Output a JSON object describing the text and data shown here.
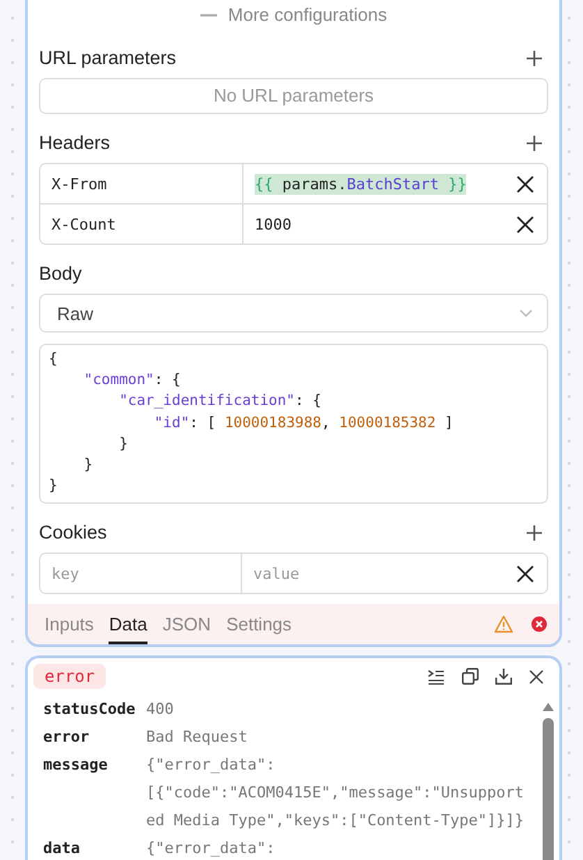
{
  "config_toggle": {
    "label": "More configurations"
  },
  "url_parameters": {
    "title": "URL parameters",
    "empty_text": "No URL parameters"
  },
  "headers": {
    "title": "Headers",
    "rows": [
      {
        "key": "X-From",
        "value": [
          {
            "kind": "brace",
            "text": "{{ "
          },
          {
            "kind": "plain",
            "text": "params"
          },
          {
            "kind": "punct",
            "text": "."
          },
          {
            "kind": "prop",
            "text": "BatchStart"
          },
          {
            "kind": "brace",
            "text": " }}"
          }
        ],
        "template": true
      },
      {
        "key": "X-Count",
        "value": [
          {
            "kind": "plain",
            "text": "1000"
          }
        ],
        "template": false
      }
    ]
  },
  "body": {
    "title": "Body",
    "type": "Raw",
    "code": [
      [
        {
          "kind": "punct",
          "text": "{"
        }
      ],
      [
        {
          "kind": "key",
          "text": "    \"common\""
        },
        {
          "kind": "punct",
          "text": ": {"
        }
      ],
      [
        {
          "kind": "key",
          "text": "        \"car_identification\""
        },
        {
          "kind": "punct",
          "text": ": {"
        }
      ],
      [
        {
          "kind": "key",
          "text": "            \"id\""
        },
        {
          "kind": "punct",
          "text": ": [ "
        },
        {
          "kind": "number",
          "text": "10000183988"
        },
        {
          "kind": "punct",
          "text": ", "
        },
        {
          "kind": "number",
          "text": "10000185382"
        },
        {
          "kind": "punct",
          "text": " ]"
        }
      ],
      [
        {
          "kind": "punct",
          "text": "        }"
        }
      ],
      [
        {
          "kind": "punct",
          "text": "    }"
        }
      ],
      [
        {
          "kind": "punct",
          "text": "}"
        }
      ]
    ]
  },
  "cookies": {
    "title": "Cookies",
    "key_placeholder": "key",
    "value_placeholder": "value"
  },
  "tabs": [
    {
      "label": "Inputs",
      "selected": false
    },
    {
      "label": "Data",
      "selected": true
    },
    {
      "label": "JSON",
      "selected": false
    },
    {
      "label": "Settings",
      "selected": false
    }
  ],
  "node_status": {
    "warning": true,
    "error": true
  },
  "output": {
    "badge": "error",
    "rows": [
      {
        "key": "statusCode",
        "value": "400"
      },
      {
        "key": "error",
        "value": "Bad Request"
      },
      {
        "key": "message",
        "value": "{\"error_data\": [{\"code\":\"ACOM0415E\",\"message\":\"Unsupported Media Type\",\"keys\":[\"Content-Type\"]}]}"
      },
      {
        "key": "data",
        "value": "{\"error_data\":"
      }
    ]
  }
}
